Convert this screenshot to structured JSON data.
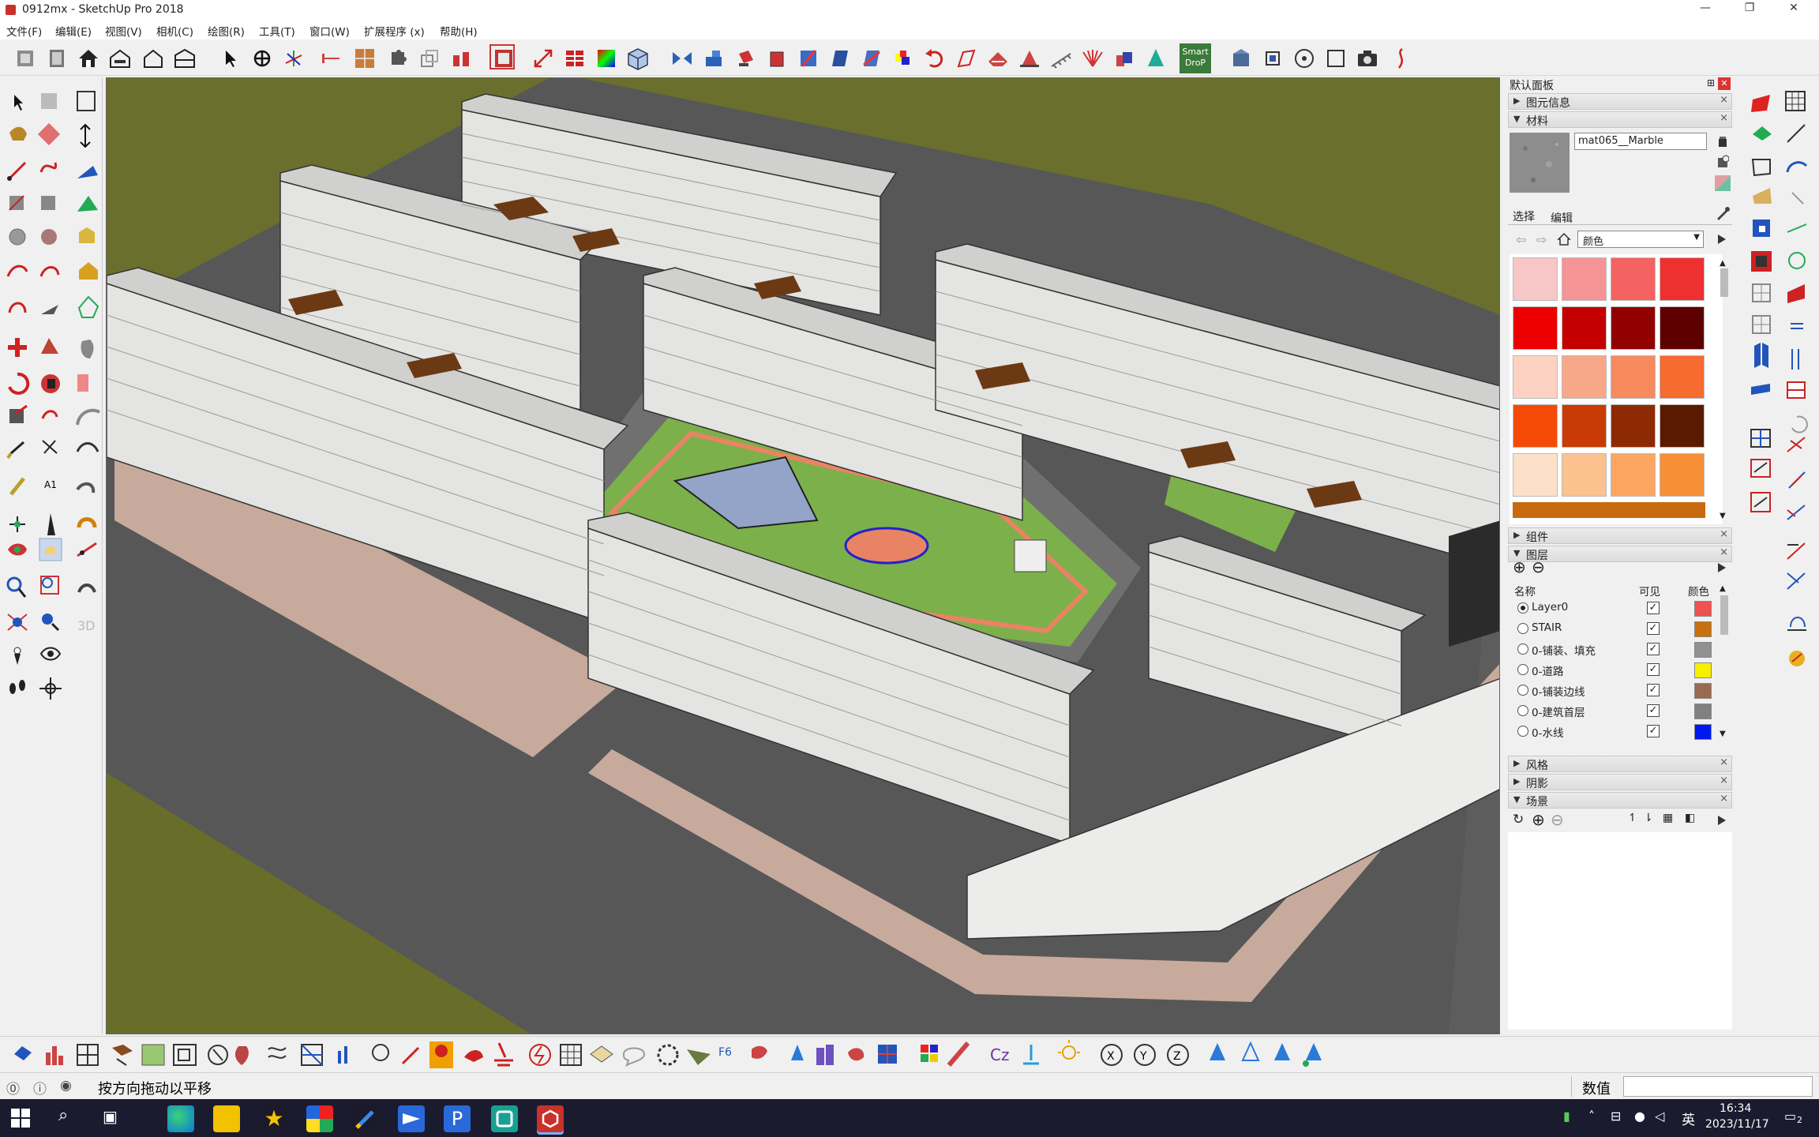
{
  "window": {
    "title": "0912mx - SketchUp Pro 2018",
    "min": "—",
    "restore": "❐",
    "close": "✕"
  },
  "menu": [
    "文件(F)",
    "编辑(E)",
    "视图(V)",
    "相机(C)",
    "绘图(R)",
    "工具(T)",
    "窗口(W)",
    "扩展程序 (x)",
    "帮助(H)"
  ],
  "toolbar": {
    "smart_drop": "Smart DroP"
  },
  "tray": {
    "title": "默认面板",
    "pin": "⊞",
    "close": "✕",
    "entity_info": "图元信息",
    "materials": {
      "label": "材料",
      "name_value": "mat065__Marble",
      "tab_select": "选择",
      "tab_edit": "编辑",
      "library": "颜色",
      "swatches": [
        "#f7c6c6",
        "#f59494",
        "#f46262",
        "#ee3030",
        "#ec0000",
        "#c40000",
        "#920000",
        "#5e0000",
        "#fdd2c2",
        "#f8a889",
        "#f78a5e",
        "#f76a30",
        "#f54a05",
        "#c93b04",
        "#8e2a03",
        "#5a1a02",
        "#fde0c8",
        "#fbc18f",
        "#fba663",
        "#f78f37"
      ]
    },
    "components": "组件",
    "layers": {
      "label": "图层",
      "col_name": "名称",
      "col_visible": "可见",
      "col_color": "颜色",
      "rows": [
        {
          "name": "Layer0",
          "active": true,
          "color": "#f05050"
        },
        {
          "name": "STAIR",
          "active": false,
          "color": "#c87010"
        },
        {
          "name": "0-铺装、填充",
          "active": false,
          "color": "#909090"
        },
        {
          "name": "0-道路",
          "active": false,
          "color": "#f6f000"
        },
        {
          "name": "0-铺装边线",
          "active": false,
          "color": "#9a6a50"
        },
        {
          "name": "0-建筑首层",
          "active": false,
          "color": "#808080"
        },
        {
          "name": "0-水线",
          "active": false,
          "color": "#0018f0"
        }
      ]
    },
    "styles": "风格",
    "shadows": "阴影",
    "scenes": "场景"
  },
  "status": {
    "hint": "按方向拖动以平移",
    "value_label": "数值",
    "value": ""
  },
  "taskbar": {
    "time": "16:34",
    "date": "2023/11/17",
    "ime": "英",
    "notif": "2"
  },
  "colors": {
    "grass": "#6b6f2e",
    "road": "#585858",
    "building": "#e4e4e2",
    "pavement": "#c8aca0",
    "greenspace": "#7cb04a",
    "track": "#e88464"
  }
}
